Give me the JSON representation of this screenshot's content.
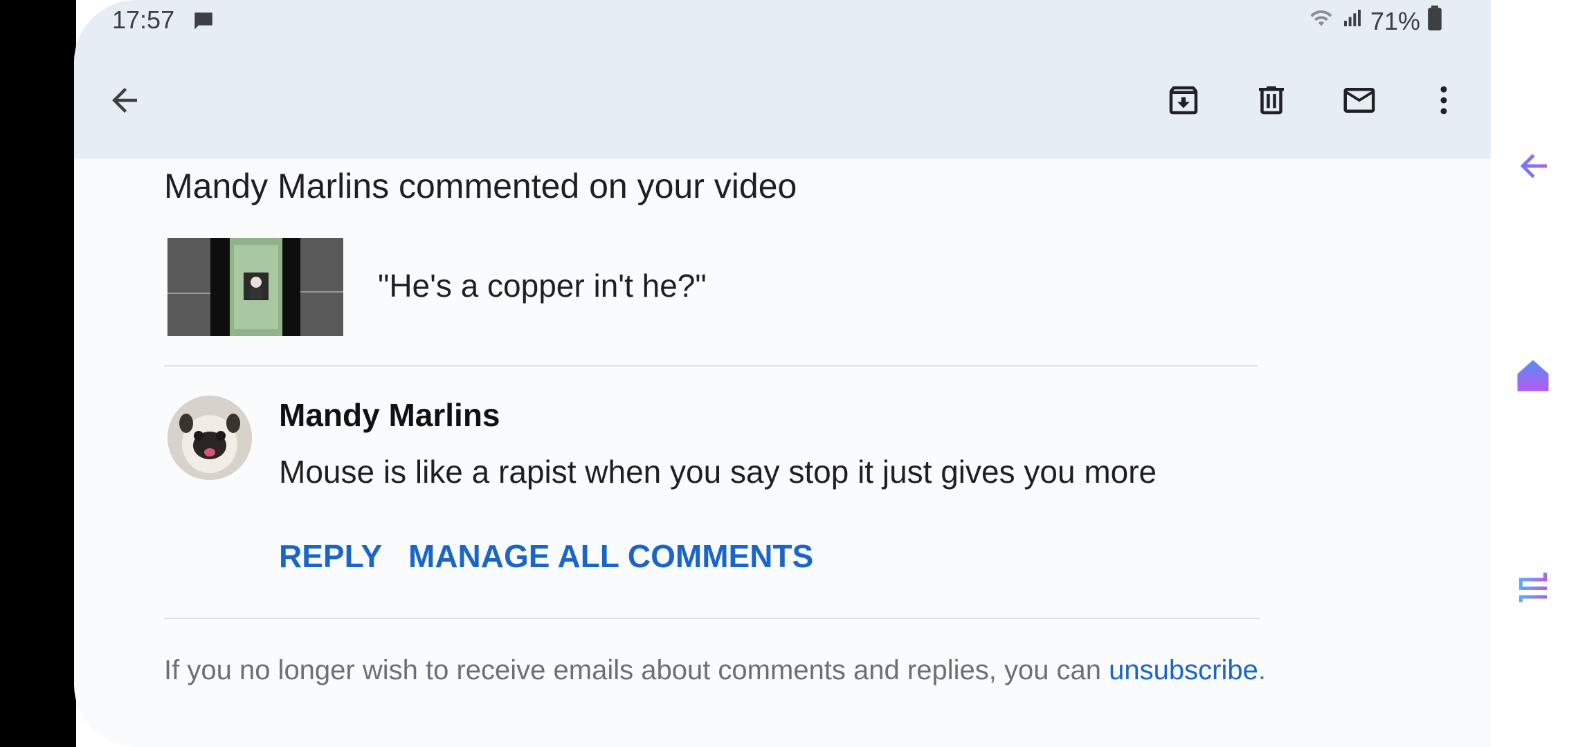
{
  "status": {
    "time": "17:57",
    "battery": "71%"
  },
  "toolbar": {
    "back": "back-arrow-icon",
    "archive": "archive-icon",
    "delete": "trash-icon",
    "mark_unread": "mail-icon",
    "more": "more-vert-icon"
  },
  "email": {
    "subject": "Mandy Marlins commented on your video",
    "quote": "\"He's a copper in't he?\"",
    "author": "Mandy Marlins",
    "comment": "Mouse is like a rapist when you say stop it just gives you more",
    "reply_label": "REPLY",
    "manage_label": "MANAGE ALL COMMENTS",
    "footer_text": "If you no longer wish to receive emails about comments and replies, you can ",
    "unsubscribe_label": "unsubscribe",
    "footer_end": "."
  },
  "colors": {
    "accent": "#1a66c8",
    "topbar": "#e6edf5",
    "edge_icons": "#9b5cf0"
  }
}
